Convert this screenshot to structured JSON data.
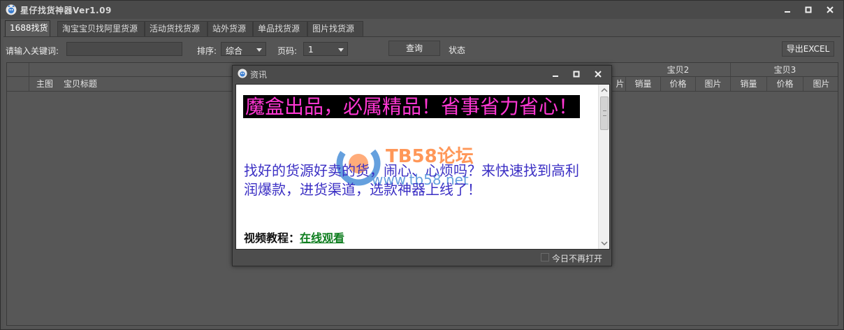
{
  "app": {
    "title": "星仔找货神器Ver1.09",
    "controls": {
      "minimize": "minimize-icon",
      "maximize": "maximize-icon",
      "close": "close-icon"
    }
  },
  "tabs": [
    {
      "label": "1688找货",
      "active": true
    },
    {
      "label": "淘宝宝贝找阿里货源",
      "active": false
    },
    {
      "label": "活动货找货源",
      "active": false
    },
    {
      "label": "站外货源",
      "active": false
    },
    {
      "label": "单品找货源",
      "active": false
    },
    {
      "label": "图片找货源",
      "active": false
    }
  ],
  "search": {
    "keyword_label": "请输入关键词:",
    "keyword_value": "",
    "sort_label": "排序:",
    "sort_value": "综合",
    "page_label": "页码:",
    "page_value": "1",
    "query_button": "查询",
    "status_label": "状态",
    "export_button": "导出EXCEL"
  },
  "grid": {
    "col_main_image": "主图",
    "col_title": "宝贝标题",
    "group_item2": "宝贝2",
    "group_item3": "宝贝3",
    "col_sales": "销量",
    "col_price": "价格",
    "col_image": "图片",
    "partial_col": "片"
  },
  "popup": {
    "title": "资讯",
    "headline": "魔盒出品，必属精品！省事省力省心！",
    "body": "找好的货源好卖的货，闹心、心烦吗？来快速找到高利润爆款，进货渠道，选款神器上线了！",
    "video_label": "视频教程：",
    "video_link": "在线观看",
    "dont_show_today": "今日不再打开",
    "watermark_text": "TB58论坛",
    "watermark_url": "www.tb58.net"
  },
  "colors": {
    "background": "#535353",
    "headline_text": "#ff37d4",
    "headline_bg": "#000000",
    "body_text": "#3b2fc4",
    "link": "#0d7d1e"
  }
}
